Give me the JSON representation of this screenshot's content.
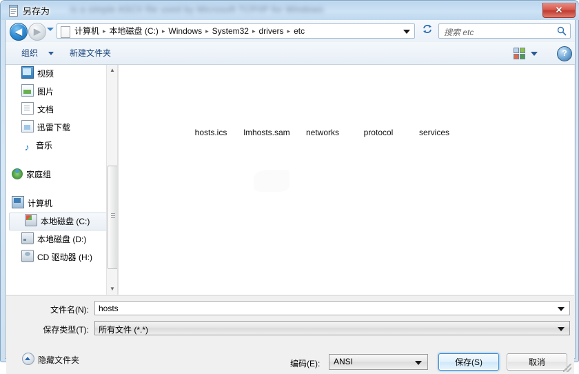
{
  "window": {
    "title": "另存为",
    "title_icon": "notepad-icon",
    "glass_background_text": "is a simple ASCII file used by Microsoft TCP/IP for Windows",
    "close_label": "✕"
  },
  "navigation": {
    "back_glyph": "◀",
    "back_name": "back-button",
    "forward_glyph": "▶",
    "forward_name": "forward-button",
    "history_dropdown": "recent-locations-dropdown",
    "breadcrumbs": [
      "计算机",
      "本地磁盘 (C:)",
      "Windows",
      "System32",
      "drivers",
      "etc"
    ],
    "separator": "▸",
    "address_dropdown": "previous-locations-dropdown",
    "refresh_glyph": "↻",
    "refresh_label": "刷新"
  },
  "search": {
    "placeholder": "搜索 etc",
    "icon": "search-icon"
  },
  "toolbar": {
    "organize_label": "组织",
    "new_folder_label": "新建文件夹",
    "view_icon": "view-options-icon",
    "help_label": "?"
  },
  "sidebar": {
    "items": [
      {
        "label": "视频",
        "icon": "video-icon",
        "indent": 1,
        "selected": false
      },
      {
        "label": "图片",
        "icon": "picture-icon",
        "indent": 1,
        "selected": false
      },
      {
        "label": "文档",
        "icon": "document-icon",
        "indent": 1,
        "selected": false
      },
      {
        "label": "迅雷下载",
        "icon": "download-icon",
        "indent": 1,
        "selected": false
      },
      {
        "label": "音乐",
        "icon": "music-icon",
        "indent": 1,
        "selected": false
      },
      {
        "label": "家庭组",
        "icon": "homegroup-icon",
        "indent": 0,
        "selected": false
      },
      {
        "label": "计算机",
        "icon": "computer-icon",
        "indent": 0,
        "selected": false
      },
      {
        "label": "本地磁盘 (C:)",
        "icon": "windows-drive-icon",
        "indent": 1,
        "selected": true
      },
      {
        "label": "本地磁盘 (D:)",
        "icon": "hard-drive-icon",
        "indent": 1,
        "selected": false
      },
      {
        "label": "CD 驱动器 (H:)",
        "icon": "cd-drive-icon",
        "indent": 1,
        "selected": false
      }
    ],
    "scrollbar": {
      "up_glyph": "▲",
      "down_glyph": "▼"
    }
  },
  "file_list": {
    "items": [
      {
        "name": "hosts.ics"
      },
      {
        "name": "lmhosts.sam"
      },
      {
        "name": "networks"
      },
      {
        "name": "protocol"
      },
      {
        "name": "services"
      }
    ]
  },
  "form": {
    "filename_label": "文件名(N):",
    "filename_value": "hosts",
    "filetype_label": "保存类型(T):",
    "filetype_value": "所有文件  (*.*)"
  },
  "actions": {
    "hide_folders_label": "隐藏文件夹",
    "hide_folders_icon": "chevron-up-circle-icon",
    "encoding_label": "编码(E):",
    "encoding_value": "ANSI",
    "save_label": "保存(S)",
    "cancel_label": "取消"
  },
  "colors": {
    "accent_blue": "#3c8ad0",
    "title_glass": "#cde2f5",
    "close_red": "#c03a2e",
    "toolbar_link": "#18427c"
  }
}
